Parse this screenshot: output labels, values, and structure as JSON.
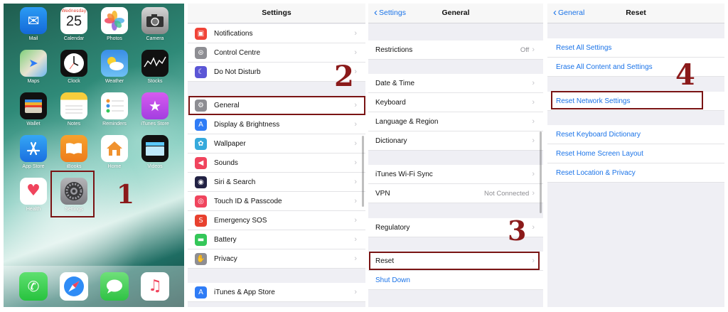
{
  "home": {
    "apps": [
      {
        "label": "Mail",
        "icon": "mail-icon"
      },
      {
        "label": "Calendar",
        "icon": "calendar-icon",
        "day": "Wednesday",
        "date": "25"
      },
      {
        "label": "Photos",
        "icon": "photos-icon"
      },
      {
        "label": "Camera",
        "icon": "camera-icon"
      },
      {
        "label": "Maps",
        "icon": "maps-icon"
      },
      {
        "label": "Clock",
        "icon": "clock-icon"
      },
      {
        "label": "Weather",
        "icon": "weather-icon"
      },
      {
        "label": "Stocks",
        "icon": "stocks-icon"
      },
      {
        "label": "Wallet",
        "icon": "wallet-icon"
      },
      {
        "label": "Notes",
        "icon": "notes-icon"
      },
      {
        "label": "Reminders",
        "icon": "reminders-icon"
      },
      {
        "label": "iTunes Store",
        "icon": "itunes-store-icon"
      },
      {
        "label": "App Store",
        "icon": "app-store-icon"
      },
      {
        "label": "iBooks",
        "icon": "ibooks-icon"
      },
      {
        "label": "Home",
        "icon": "home-icon"
      },
      {
        "label": "Videos",
        "icon": "videos-icon"
      },
      {
        "label": "Health",
        "icon": "health-icon"
      },
      {
        "label": "Settings",
        "icon": "settings-icon"
      }
    ],
    "dock": [
      {
        "icon": "phone-icon"
      },
      {
        "icon": "safari-icon"
      },
      {
        "icon": "messages-icon"
      },
      {
        "icon": "music-icon"
      }
    ]
  },
  "steps": [
    "1",
    "2",
    "3",
    "4"
  ],
  "settings": {
    "title": "Settings",
    "rows": [
      {
        "label": "Notifications",
        "icon": "notifications-icon",
        "color": "#f04438"
      },
      {
        "label": "Control Centre",
        "icon": "control-centre-icon",
        "color": "#8e8e93"
      },
      {
        "label": "Do Not Disturb",
        "icon": "moon-icon",
        "color": "#5b56d6"
      },
      {
        "label": "General",
        "icon": "gear-icon",
        "color": "#8e8e93"
      },
      {
        "label": "Display & Brightness",
        "icon": "display-icon",
        "color": "#2f7cf6"
      },
      {
        "label": "Wallpaper",
        "icon": "wallpaper-icon",
        "color": "#36aadc"
      },
      {
        "label": "Sounds",
        "icon": "sounds-icon",
        "color": "#f0445d"
      },
      {
        "label": "Siri & Search",
        "icon": "siri-icon",
        "color": "#222244"
      },
      {
        "label": "Touch ID & Passcode",
        "icon": "fingerprint-icon",
        "color": "#f0445d"
      },
      {
        "label": "Emergency SOS",
        "icon": "sos-icon",
        "color": "#e8412f"
      },
      {
        "label": "Battery",
        "icon": "battery-icon",
        "color": "#34c759"
      },
      {
        "label": "Privacy",
        "icon": "privacy-hand-icon",
        "color": "#8e8e93"
      },
      {
        "label": "iTunes & App Store",
        "icon": "app-store-icon",
        "color": "#2f7cf6"
      }
    ]
  },
  "general": {
    "back": "Settings",
    "title": "General",
    "rows": [
      {
        "label": "Restrictions",
        "detail": "Off"
      },
      {
        "label": "Date & Time",
        "detail": ""
      },
      {
        "label": "Keyboard",
        "detail": ""
      },
      {
        "label": "Language & Region",
        "detail": ""
      },
      {
        "label": "Dictionary",
        "detail": ""
      },
      {
        "label": "iTunes Wi-Fi Sync",
        "detail": ""
      },
      {
        "label": "VPN",
        "detail": "Not Connected"
      },
      {
        "label": "Regulatory",
        "detail": ""
      },
      {
        "label": "Reset",
        "detail": ""
      },
      {
        "label": "Shut Down",
        "detail": ""
      }
    ]
  },
  "reset": {
    "back": "General",
    "title": "Reset",
    "rows": [
      "Reset All Settings",
      "Erase All Content and Settings",
      "Reset Network Settings",
      "Reset Keyboard Dictionary",
      "Reset Home Screen Layout",
      "Reset Location & Privacy"
    ]
  }
}
